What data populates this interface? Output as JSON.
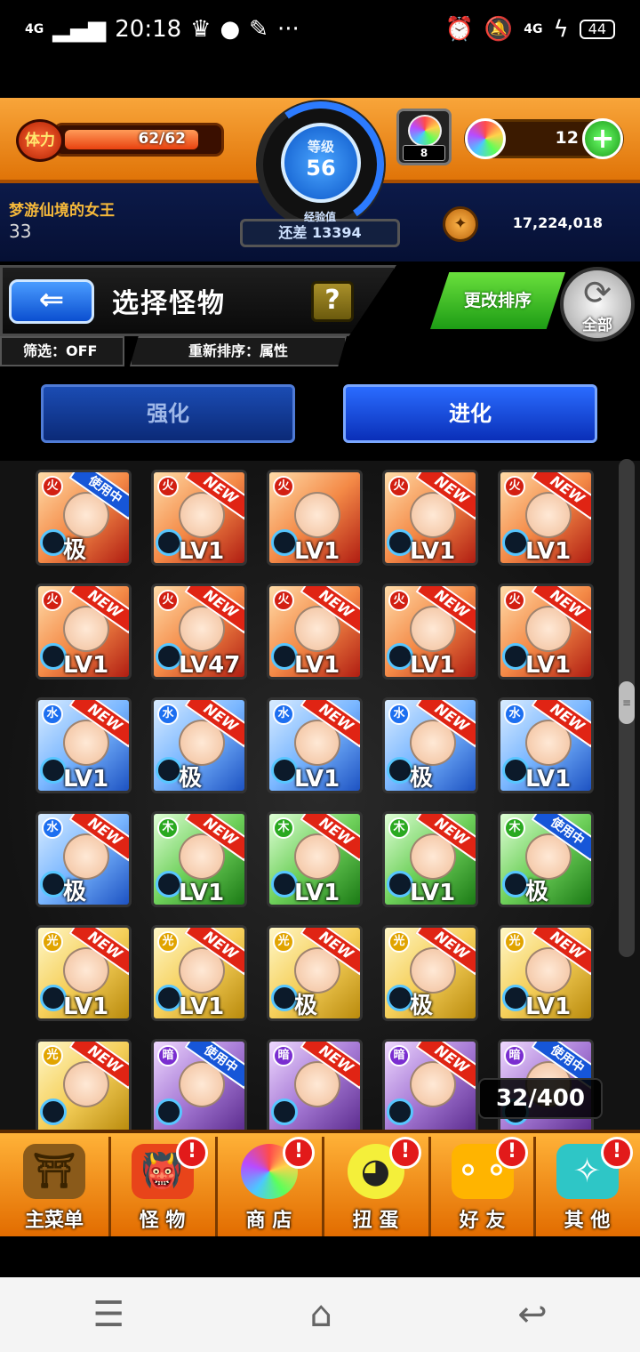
{
  "status_bar": {
    "network": "4G",
    "time": "20:18",
    "dots": "···",
    "right_network": "4G",
    "battery": "44"
  },
  "header": {
    "stamina_label": "体力",
    "stamina_value": "62/62",
    "stamina_fraction": 1.0,
    "level_label": "等级",
    "level_value": "56",
    "exp_label": "经验值",
    "exp_remaining": "还差 13394",
    "orb_count": "8",
    "gem_count": "12",
    "gem_plus": "+",
    "player_name": "梦游仙境的女王",
    "player_rank": "33",
    "coin_value": "17,224,018"
  },
  "title_bar": {
    "back_label": "⇐",
    "title": "选择怪物",
    "help_label": "?",
    "filter": "筛选：OFF",
    "sort": "重新排序：属性",
    "resort_button": "更改排序",
    "all_button": "全部"
  },
  "tabs": [
    {
      "label": "强化",
      "active": false
    },
    {
      "label": "进化",
      "active": true
    }
  ],
  "monsters": [
    {
      "element": "fire",
      "level": "极",
      "badge": "使用中"
    },
    {
      "element": "fire",
      "level": "LV1",
      "badge": "NEW"
    },
    {
      "element": "fire",
      "level": "LV1",
      "badge": ""
    },
    {
      "element": "fire",
      "level": "LV1",
      "badge": "NEW"
    },
    {
      "element": "fire",
      "level": "LV1",
      "badge": "NEW"
    },
    {
      "element": "fire",
      "level": "LV1",
      "badge": "NEW"
    },
    {
      "element": "fire",
      "level": "LV47",
      "badge": "NEW"
    },
    {
      "element": "fire",
      "level": "LV1",
      "badge": "NEW"
    },
    {
      "element": "fire",
      "level": "LV1",
      "badge": "NEW"
    },
    {
      "element": "fire",
      "level": "LV1",
      "badge": "NEW"
    },
    {
      "element": "water",
      "level": "LV1",
      "badge": "NEW"
    },
    {
      "element": "water",
      "level": "极",
      "badge": "NEW"
    },
    {
      "element": "water",
      "level": "LV1",
      "badge": "NEW"
    },
    {
      "element": "water",
      "level": "极",
      "badge": "NEW"
    },
    {
      "element": "water",
      "level": "LV1",
      "badge": "NEW"
    },
    {
      "element": "water",
      "level": "极",
      "badge": "NEW"
    },
    {
      "element": "wood",
      "level": "LV1",
      "badge": "NEW"
    },
    {
      "element": "wood",
      "level": "LV1",
      "badge": "NEW"
    },
    {
      "element": "wood",
      "level": "LV1",
      "badge": "NEW"
    },
    {
      "element": "wood",
      "level": "极",
      "badge": "使用中"
    },
    {
      "element": "light",
      "level": "LV1",
      "badge": "NEW"
    },
    {
      "element": "light",
      "level": "LV1",
      "badge": "NEW"
    },
    {
      "element": "light",
      "level": "极",
      "badge": "NEW"
    },
    {
      "element": "light",
      "level": "极",
      "badge": "NEW"
    },
    {
      "element": "light",
      "level": "LV1",
      "badge": "NEW"
    },
    {
      "element": "light",
      "level": "",
      "badge": "NEW"
    },
    {
      "element": "dark",
      "level": "",
      "badge": "使用中"
    },
    {
      "element": "dark",
      "level": "",
      "badge": "NEW"
    },
    {
      "element": "dark",
      "level": "",
      "badge": "NEW"
    },
    {
      "element": "dark",
      "level": "",
      "badge": "使用中"
    }
  ],
  "box_count": "32/400",
  "bottom_nav": [
    {
      "label": "主菜单",
      "icon": "home-gate-icon",
      "alert": ""
    },
    {
      "label": "怪 物",
      "icon": "monster-icon",
      "alert": "!"
    },
    {
      "label": "商 店",
      "icon": "rainbow-orb-icon",
      "alert": "!"
    },
    {
      "label": "扭 蛋",
      "icon": "egg-icon",
      "alert": "!"
    },
    {
      "label": "好 友",
      "icon": "balloons-icon",
      "alert": "!"
    },
    {
      "label": "其 他",
      "icon": "wrench-icon",
      "alert": "!"
    }
  ],
  "system_nav": {
    "menu_icon": "menu-icon",
    "home_icon": "home-icon",
    "back_icon": "back-icon"
  },
  "colors": {
    "header_orange": "#f8a53a",
    "header_navy": "#0c1a49",
    "accent_blue": "#2a6cff",
    "resort_green": "#1d9c15",
    "new_badge": "#e02414",
    "in_use_badge": "#1656d8"
  }
}
